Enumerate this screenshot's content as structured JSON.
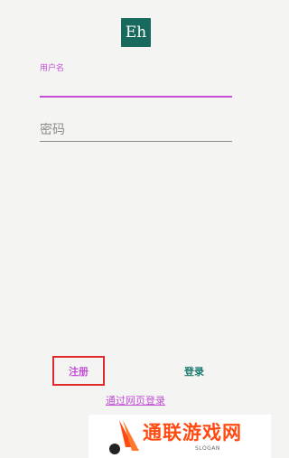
{
  "app": {
    "logo_text": "Eh",
    "logo_color": "#186a5e",
    "accent_color": "#c34fd8",
    "secondary_color": "#1f7b72"
  },
  "form": {
    "username_label": "用户名",
    "username_value": "",
    "password_placeholder": "密码",
    "password_value": ""
  },
  "actions": {
    "register_label": "注册",
    "login_label": "登录",
    "web_login_label": "通过网页登录",
    "highlight_color": "#e02a2a"
  },
  "watermark": {
    "text": "通联游戏网",
    "slogan": "SLOGAN",
    "icon": "site-logo-icon"
  }
}
